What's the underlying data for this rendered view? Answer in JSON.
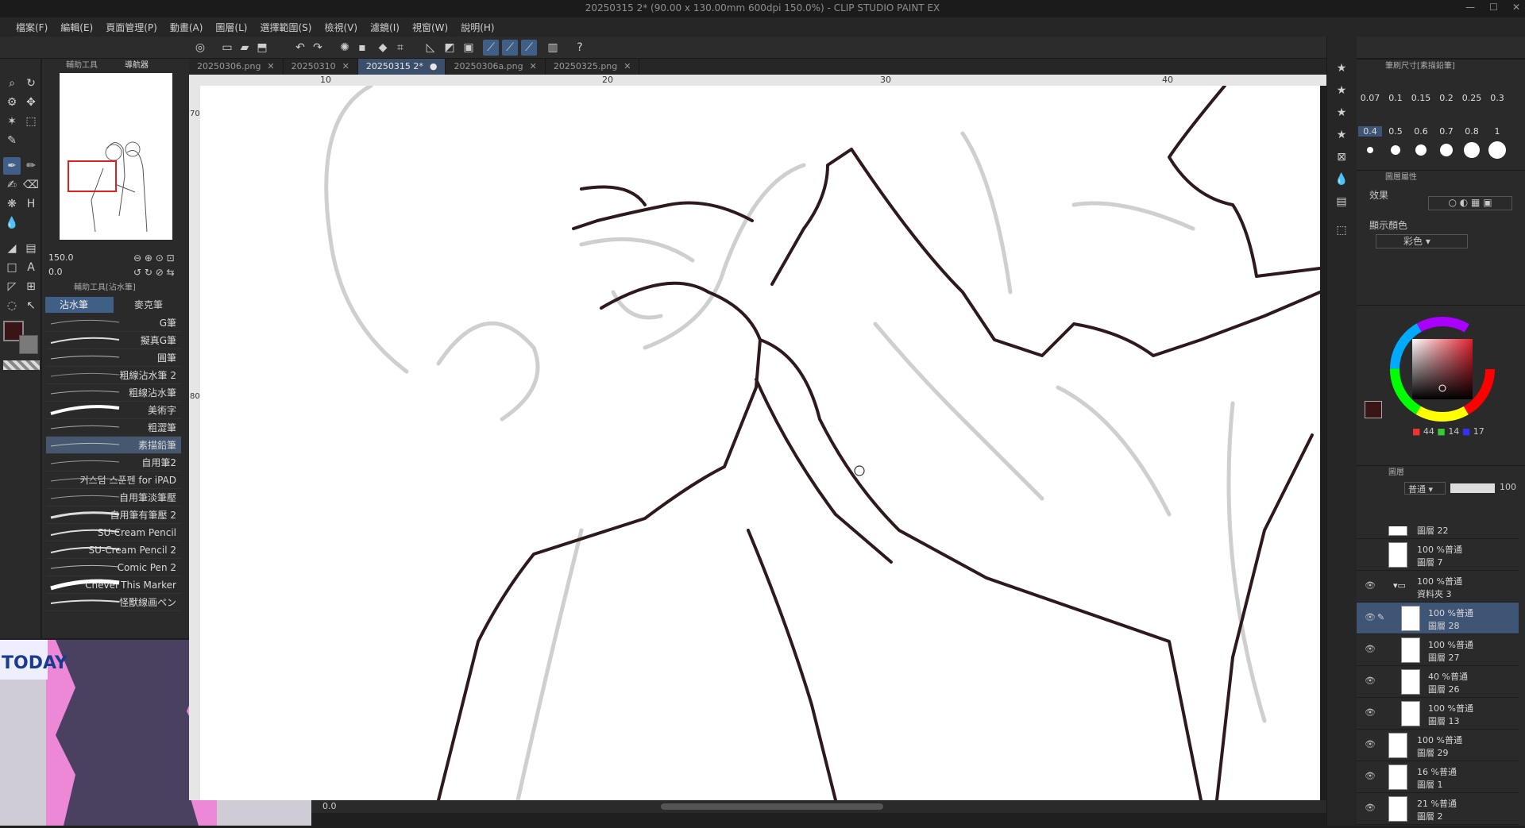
{
  "window": {
    "title": "20250315 2* (90.00 x 130.00mm 600dpi 150.0%) - CLIP STUDIO PAINT EX"
  },
  "menu": [
    "檔案(F)",
    "編輯(E)",
    "頁面管理(P)",
    "動畫(A)",
    "圖層(L)",
    "選擇範圍(S)",
    "檢視(V)",
    "濾鏡(I)",
    "視窗(W)",
    "說明(H)"
  ],
  "panels": {
    "subtool_tab": "輔助工具",
    "navigator_tab": "導航器",
    "subtool_pen_tab": "輔助工具[沾水筆]",
    "zoom": "150.0",
    "rotate": "0.0"
  },
  "pen_tabs": [
    "沾水筆",
    "麥克筆"
  ],
  "brushes": [
    "G筆",
    "擬真G筆",
    "圓筆",
    "粗線沾水筆 2",
    "粗線沾水筆",
    "美術字",
    "粗澀筆",
    "素描鉛筆",
    "自用筆2",
    "커스텀 스푼펜 for iPAD",
    "自用筆淡筆壓",
    "自用筆有筆壓 2",
    "SU-Cream Pencil",
    "SU-Cream Pencil 2",
    "Comic Pen 2",
    "Chevel This Marker",
    "怪獸線画ペン"
  ],
  "selected_brush": "素描鉛筆",
  "doc_tabs": [
    "20250306.png",
    "20250310",
    "20250315 2*",
    "20250306a.png",
    "20250325.png"
  ],
  "ruler": {
    "h": [
      "10",
      "20",
      "30",
      "40"
    ],
    "v": [
      "70",
      "80"
    ]
  },
  "status": {
    "zoom": "0.0"
  },
  "brush_size": {
    "title": "筆刷尺寸[素描鉛筆]",
    "sizes": [
      "0.07",
      "0.1",
      "0.15",
      "0.2",
      "0.25",
      "0.3",
      "0.4",
      "0.5",
      "0.6",
      "0.7",
      "0.8",
      "1"
    ]
  },
  "layer_property": {
    "title": "圖層屬性",
    "effect": "效果",
    "display_color": "顯示顏色",
    "color_mode": "彩色"
  },
  "color": {
    "h": "44",
    "s": "14",
    "v": "17",
    "main": "#3a1518",
    "sub": "#7a7a7a"
  },
  "layer_panel": {
    "tab": "圖層",
    "blend": "普通",
    "opacity": "100"
  },
  "layers": [
    {
      "pct": "",
      "name": "圖層 22"
    },
    {
      "pct": "100 %普通",
      "name": "圖層 7"
    },
    {
      "pct": "100 %普通",
      "name": "資料夾 3"
    },
    {
      "pct": "100 %普通",
      "name": "圖層 28"
    },
    {
      "pct": "100 %普通",
      "name": "圖層 27"
    },
    {
      "pct": "40 %普通",
      "name": "圖層 26"
    },
    {
      "pct": "100 %普通",
      "name": "圖層 13"
    },
    {
      "pct": "100 %普通",
      "name": "圖層 29"
    },
    {
      "pct": "16 %普通",
      "name": "圖層 1"
    },
    {
      "pct": "21 %普通",
      "name": "圖層 2"
    }
  ],
  "thumb_logo": "TODAY"
}
